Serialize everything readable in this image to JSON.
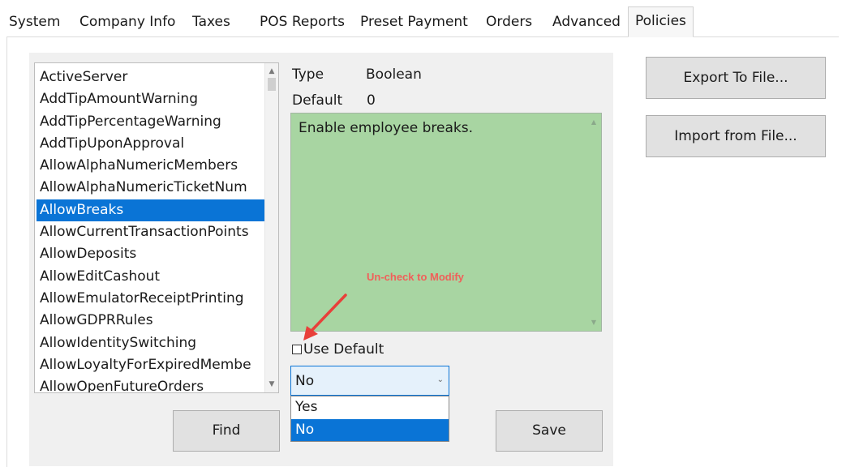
{
  "tabs": [
    "System",
    "Company Info",
    "Taxes",
    "POS Reports",
    "Preset Payment",
    "Orders",
    "Advanced",
    "Policies"
  ],
  "active_tab": "Policies",
  "policy_list": {
    "items": [
      "ActiveServer",
      "AddTipAmountWarning",
      "AddTipPercentageWarning",
      "AddTipUponApproval",
      "AllowAlphaNumericMembers",
      "AllowAlphaNumericTicketNum",
      "AllowBreaks",
      "AllowCurrentTransactionPoints",
      "AllowDeposits",
      "AllowEditCashout",
      "AllowEmulatorReceiptPrinting",
      "AllowGDPRRules",
      "AllowIdentitySwitching",
      "AllowLoyaltyForExpiredMembe",
      "AllowOpenFutureOrders"
    ],
    "selected": "AllowBreaks"
  },
  "details": {
    "type_label": "Type",
    "type_value": "Boolean",
    "default_label": "Default",
    "default_value": "0",
    "description": "Enable employee breaks.",
    "hint": "Un-check to Modify",
    "use_default_label": "Use Default",
    "use_default_checked": false
  },
  "value_dropdown": {
    "value": "No",
    "options": [
      "Yes",
      "No"
    ],
    "highlighted": "No"
  },
  "buttons": {
    "find": "Find",
    "save": "Save",
    "export": "Export To File...",
    "import": "Import from File..."
  },
  "colors": {
    "selection": "#0a74d6",
    "description_bg": "#a8d5a2",
    "hint": "#f0605a",
    "arrow": "#e8403a"
  }
}
